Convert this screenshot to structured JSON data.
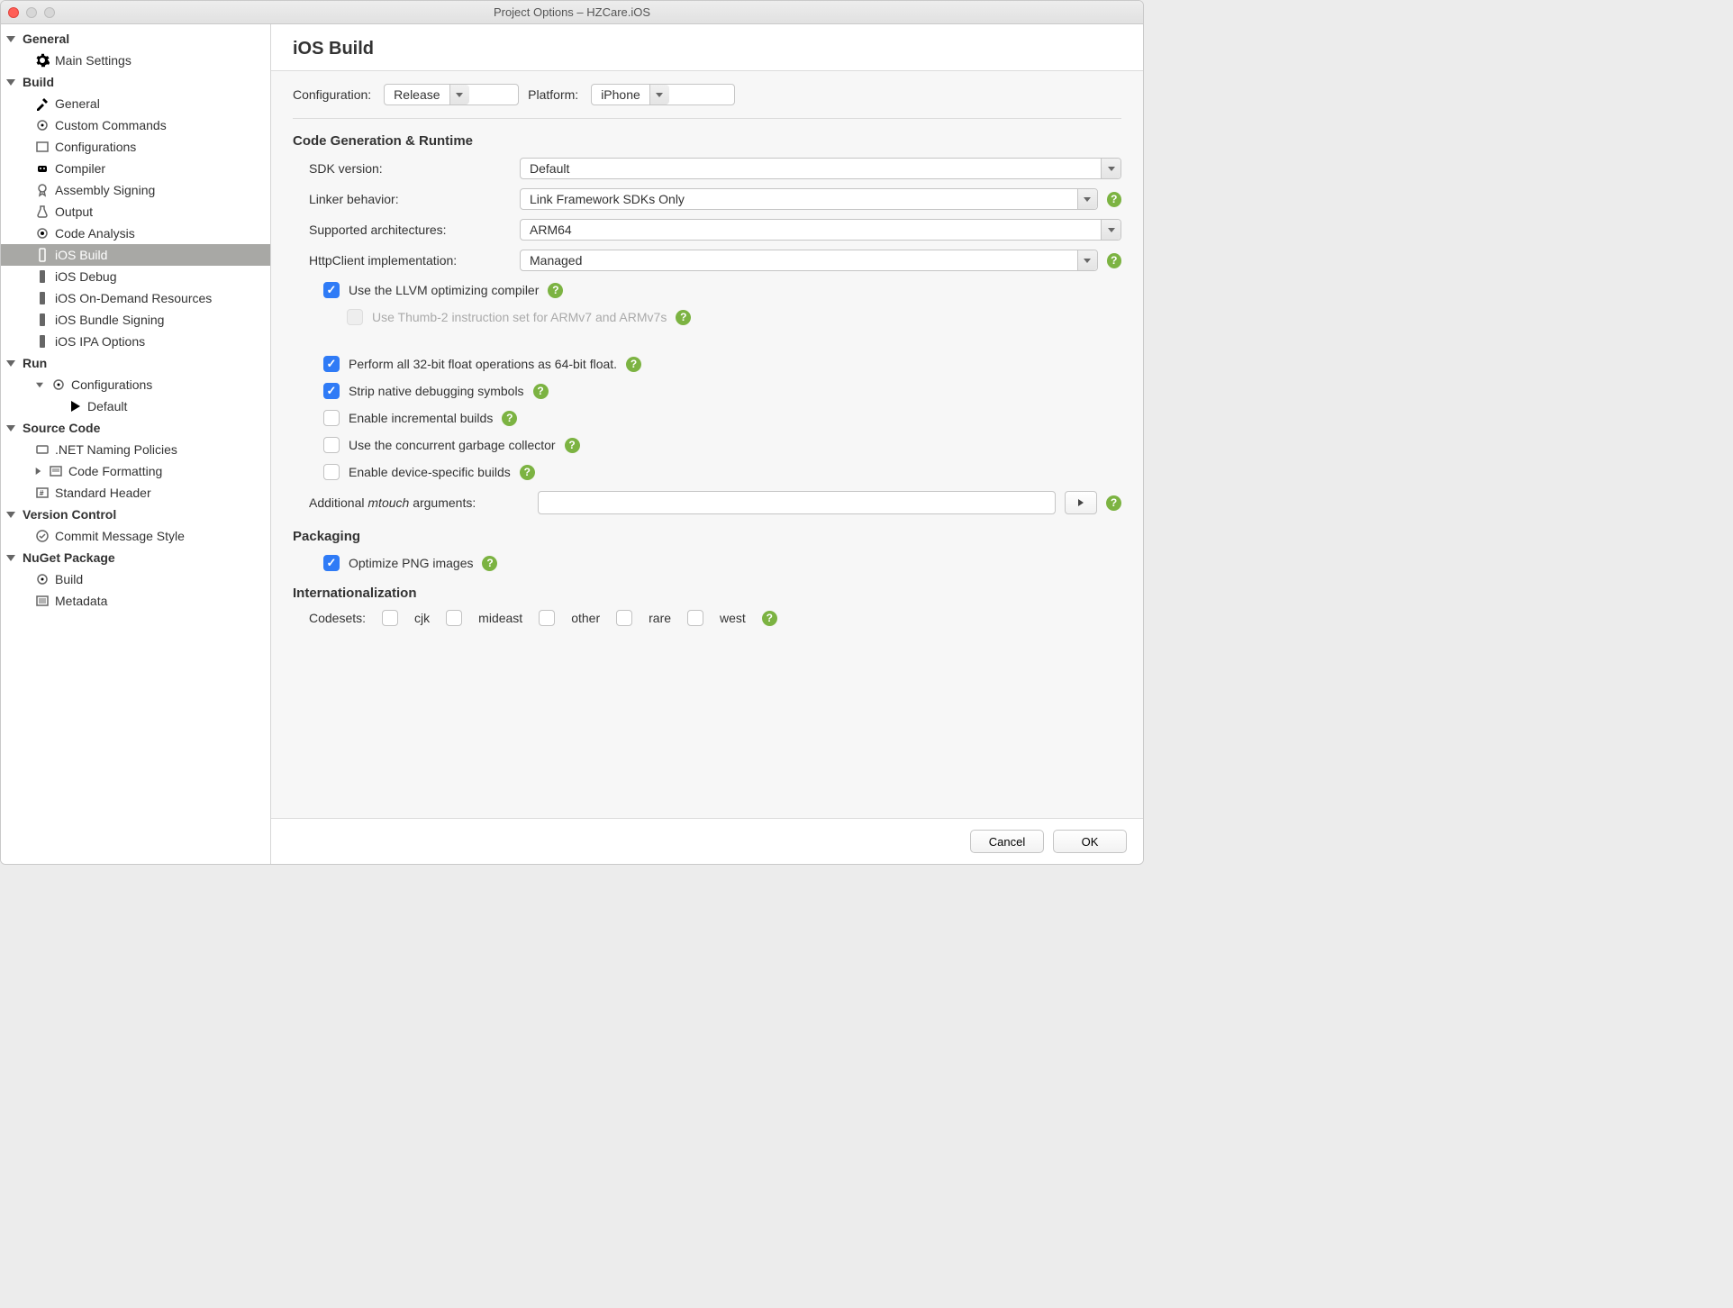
{
  "window": {
    "title": "Project Options – HZCare.iOS"
  },
  "sidebar": {
    "general": {
      "label": "General",
      "main_settings": "Main Settings"
    },
    "build": {
      "label": "Build",
      "items": [
        "General",
        "Custom Commands",
        "Configurations",
        "Compiler",
        "Assembly Signing",
        "Output",
        "Code Analysis",
        "iOS Build",
        "iOS Debug",
        "iOS On-Demand Resources",
        "iOS Bundle Signing",
        "iOS IPA Options"
      ]
    },
    "run": {
      "label": "Run",
      "configurations": "Configurations",
      "default": "Default"
    },
    "source_code": {
      "label": "Source Code",
      "items": [
        ".NET Naming Policies",
        "Code Formatting",
        "Standard Header"
      ]
    },
    "version_control": {
      "label": "Version Control",
      "items": [
        "Commit Message Style"
      ]
    },
    "nuget": {
      "label": "NuGet Package",
      "items": [
        "Build",
        "Metadata"
      ]
    }
  },
  "main": {
    "title": "iOS Build",
    "config_label": "Configuration:",
    "config_value": "Release",
    "platform_label": "Platform:",
    "platform_value": "iPhone",
    "sections": {
      "codegen": "Code Generation & Runtime",
      "packaging": "Packaging",
      "i18n": "Internationalization"
    },
    "fields": {
      "sdk_label": "SDK version:",
      "sdk_value": "Default",
      "linker_label": "Linker behavior:",
      "linker_value": "Link Framework SDKs Only",
      "arch_label": "Supported architectures:",
      "arch_value": "ARM64",
      "http_label": "HttpClient implementation:",
      "http_value": "Managed",
      "mtouch_label": "Additional mtouch arguments:",
      "codesets_label": "Codesets:"
    },
    "checks": {
      "llvm": "Use the LLVM optimizing compiler",
      "thumb": "Use Thumb-2 instruction set for ARMv7 and ARMv7s",
      "float": "Perform all 32-bit float operations as 64-bit float.",
      "strip": "Strip native debugging symbols",
      "incremental": "Enable incremental builds",
      "gc": "Use the concurrent garbage collector",
      "device": "Enable device-specific builds",
      "png": "Optimize PNG images"
    },
    "codesets": [
      "cjk",
      "mideast",
      "other",
      "rare",
      "west"
    ]
  },
  "footer": {
    "cancel": "Cancel",
    "ok": "OK"
  }
}
